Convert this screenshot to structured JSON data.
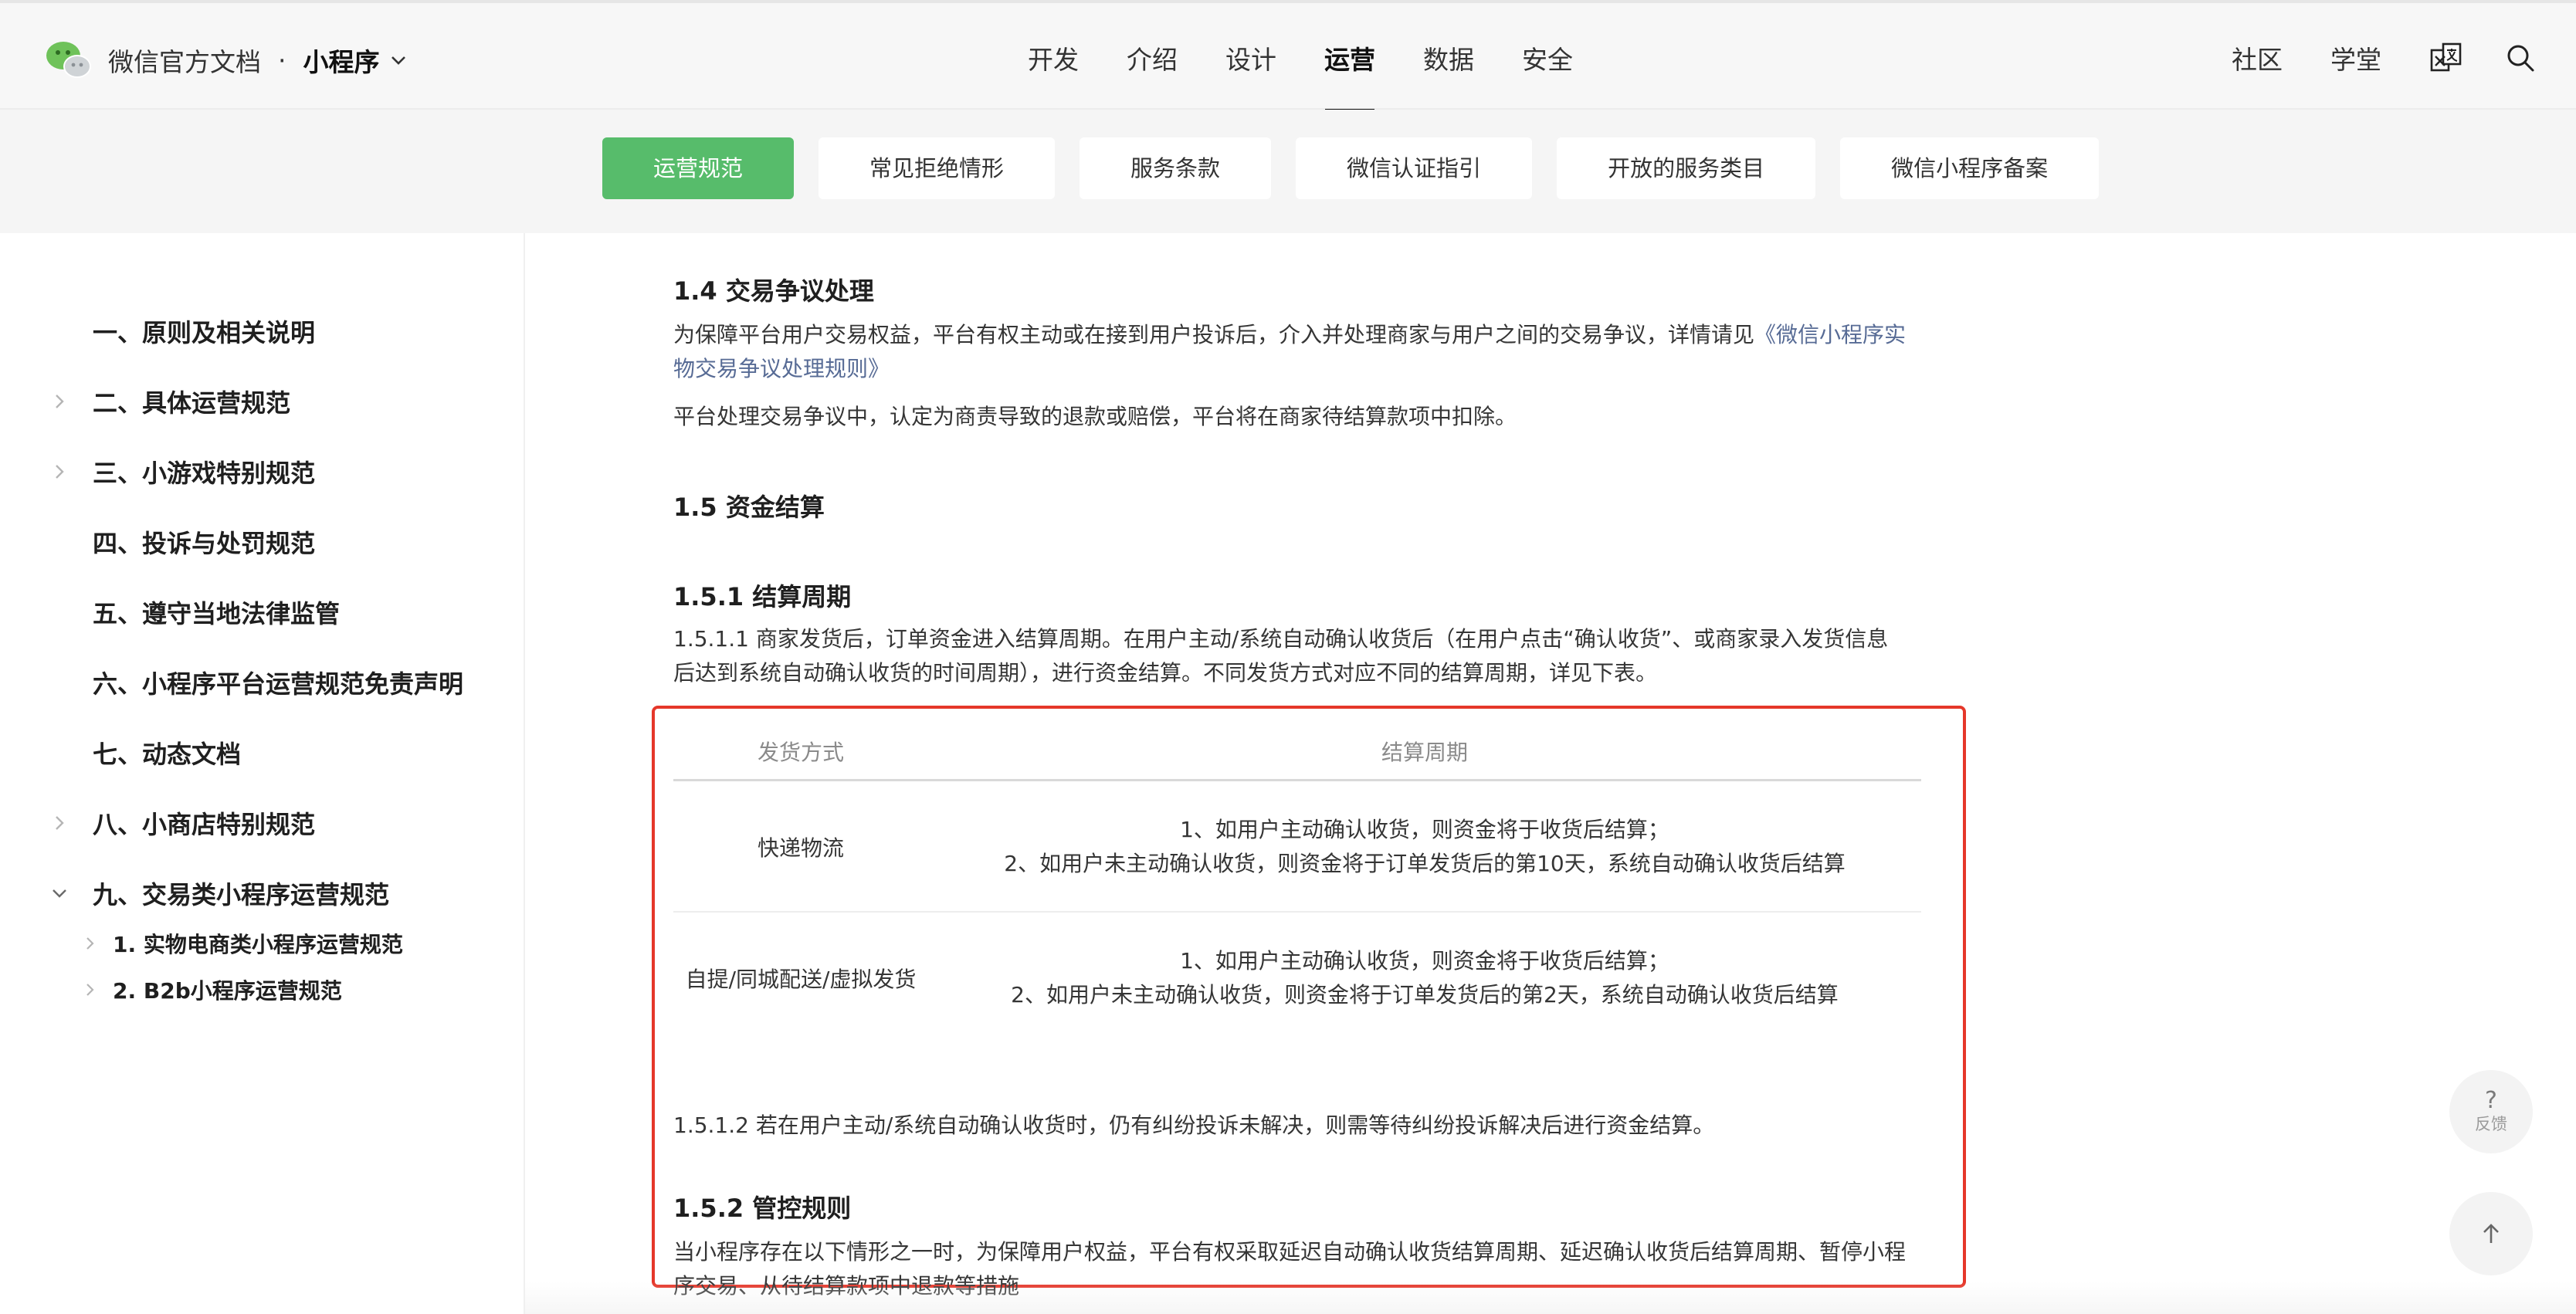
{
  "header": {
    "brand_name": "微信官方文档",
    "brand_dot": "·",
    "product": "小程序",
    "nav": [
      "开发",
      "介绍",
      "设计",
      "运营",
      "数据",
      "安全"
    ],
    "active_nav": "运营",
    "right_links": [
      "社区",
      "学堂"
    ],
    "icons": [
      "translate-icon",
      "search-icon"
    ]
  },
  "subtabs": [
    "运营规范",
    "常见拒绝情形",
    "服务条款",
    "微信认证指引",
    "开放的服务类目",
    "微信小程序备案"
  ],
  "active_subtab": "运营规范",
  "sidebar": {
    "items": [
      {
        "label": "一、原则及相关说明",
        "chevron": "none"
      },
      {
        "label": "二、具体运营规范",
        "chevron": "right"
      },
      {
        "label": "三、小游戏特别规范",
        "chevron": "right"
      },
      {
        "label": "四、投诉与处罚规范",
        "chevron": "none"
      },
      {
        "label": "五、遵守当地法律监管",
        "chevron": "none"
      },
      {
        "label": "六、小程序平台运营规范免责声明",
        "chevron": "none"
      },
      {
        "label": "七、动态文档",
        "chevron": "none"
      },
      {
        "label": "八、小商店特别规范",
        "chevron": "right"
      },
      {
        "label": "九、交易类小程序运营规范",
        "chevron": "down"
      }
    ],
    "subitems": [
      {
        "label": "1. 实物电商类小程序运营规范"
      },
      {
        "label": "2. B2b小程序运营规范"
      }
    ]
  },
  "content": {
    "s14_title": "1.4 交易争议处理",
    "s14_p1_text": "为保障平台用户交易权益，平台有权主动或在接到用户投诉后，介入并处理商家与用户之间的交易争议，详情请见",
    "s14_p1_link": "《微信小程序实物交易争议处理规则》",
    "s14_p2": "平台处理交易争议中，认定为商责导致的退款或赔偿，平台将在商家待结算款项中扣除。",
    "s15_title": "1.5 资金结算",
    "s151_title": "1.5.1 结算周期",
    "s151_p1": "1.5.1.1 商家发货后，订单资金进入结算周期。在用户主动/系统自动确认收货后（在用户点击“确认收货”、或商家录入发货信息后达到系统自动确认收货的时间周期），进行资金结算。不同发货方式对应不同的结算周期，详见下表。",
    "table": {
      "headers": [
        "发货方式",
        "结算周期"
      ],
      "rows": [
        {
          "method": "快递物流",
          "line1": "1、如用户主动确认收货，则资金将于收货后结算；",
          "line2": "2、如用户未主动确认收货，则资金将于订单发货后的第10天，系统自动确认收货后结算"
        },
        {
          "method": "自提/同城配送/虚拟发货",
          "line1": "1、如用户主动确认收货，则资金将于收货后结算；",
          "line2": "2、如用户未主动确认收货，则资金将于订单发货后的第2天，系统自动确认收货后结算"
        }
      ]
    },
    "s151_p2": "1.5.1.2 若在用户主动/系统自动确认收货时，仍有纠纷投诉未解决，则需等待纠纷投诉解决后进行资金结算。",
    "s152_title": "1.5.2 管控规则",
    "s152_p1": "当小程序存在以下情形之一时，为保障用户权益，平台有权采取延迟自动确认收货结算周期、延迟确认收货后结算周期、暂停小程序交易、从待结算款项中退款等措施"
  },
  "float": {
    "feedback_symbol": "?",
    "feedback_label": "反馈",
    "top_icon": "arrow-up-icon"
  },
  "colors": {
    "accent_green": "#57bc6b",
    "link_blue": "#576b95",
    "highlight_red": "#e5372a"
  }
}
